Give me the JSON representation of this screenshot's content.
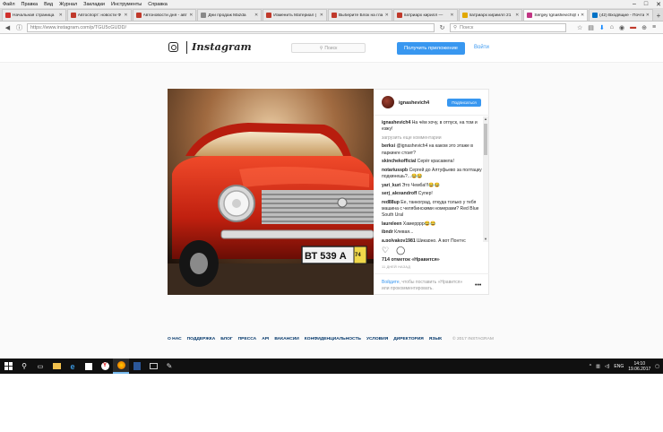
{
  "menubar": {
    "items": [
      "Файл",
      "Правка",
      "Вид",
      "Журнал",
      "Закладки",
      "Инструменты",
      "Справка"
    ]
  },
  "tabs": [
    {
      "label": "Начальная страница",
      "color": "#d0312d",
      "active": false
    },
    {
      "label": "Автоспорт: новости Ф",
      "color": "#c0392b",
      "active": false
    },
    {
      "label": "Автоновости дня - авт",
      "color": "#c0392b",
      "active": false
    },
    {
      "label": "Дни продаж Mazda",
      "color": "#888888",
      "active": false
    },
    {
      "label": "Изменить Материал |",
      "color": "#c0392b",
      "active": false
    },
    {
      "label": "Выберите Блок на гла",
      "color": "#c0392b",
      "active": false
    },
    {
      "label": "патриарх кирилл —",
      "color": "#c0392b",
      "active": false
    },
    {
      "label": "патриарх кириилл 21",
      "color": "#e1a800",
      "active": false
    },
    {
      "label": "Sergey Ignashevich@ к",
      "color": "#c13584",
      "active": true
    },
    {
      "label": "(42) Входящие - Почта",
      "color": "#0072c6",
      "active": false
    }
  ],
  "navbar": {
    "url": "https://www.instagram.com/p/TGU5cGUDD/",
    "search_placeholder": "Поиск"
  },
  "instagram": {
    "logo_text": "Instagram",
    "search_placeholder": "Поиск",
    "get_app_label": "Получить приложение",
    "login_label": "Войти"
  },
  "post": {
    "username": "ignashevich4",
    "follow_label": "Подписаться",
    "caption_user": "ignashevich4",
    "caption_text": "На чём хочу, в отпуск, на том и езжу!",
    "load_more": "загрузить еще комментарии",
    "comments": [
      {
        "user": "berksi",
        "text": "@ignashevich4 на каком это этаже в паркинге стоит?"
      },
      {
        "user": "skinchekofficial",
        "text": "Серёг красавела!"
      },
      {
        "user": "notariusspb",
        "text": "Сергей до Алтуфьево за полтацку подкинешь?...😂😂"
      },
      {
        "user": "yari_kuri",
        "text": "Это Чемба!!!😂😂"
      },
      {
        "user": "serj_alexandroff",
        "text": "Супер!"
      },
      {
        "user": "red88up",
        "text": "Ee, танкоград, откуда только у тебя машина с челябинскими номерами? Red Blue South Ural"
      },
      {
        "user": "laureleen",
        "text": "Хамерррр😂😂"
      },
      {
        "user": "ibndr",
        "text": "Клевая..."
      },
      {
        "user": "a.polyakov1981",
        "text": "Шикарно. А вот Понтус"
      }
    ],
    "likes": "714 отметок «Нравится»",
    "date": "11 ДНЕЙ НАЗАД",
    "login_prompt_link": "Войдите",
    "login_prompt_text": ", чтобы поставить «Нравится» или прокомментировать.",
    "more_dots": "•••",
    "plate": "ВТ 539 А",
    "plate_region": "74"
  },
  "footer": {
    "links": [
      "О НАС",
      "ПОДДЕРЖКА",
      "БЛОГ",
      "ПРЕССА",
      "API",
      "ВАКАНСИИ",
      "КОНФИДЕНЦИАЛЬНОСТЬ",
      "УСЛОВИЯ",
      "ДИРЕКТОРИЯ",
      "ЯЗЫК"
    ],
    "copyright": "© 2017 INSTAGRAM"
  },
  "taskbar": {
    "language": "ENG",
    "time": "14:10",
    "date": "19.06.2017"
  },
  "colors": {
    "accent": "#3897f0",
    "footer_link": "#003569"
  }
}
